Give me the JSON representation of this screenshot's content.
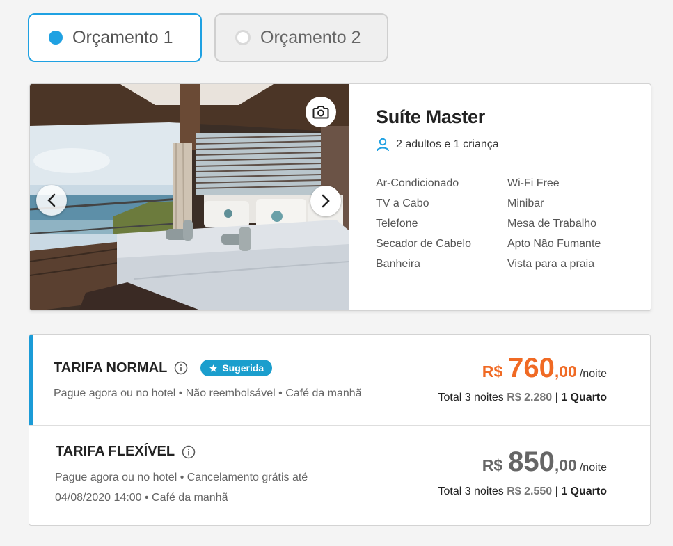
{
  "tabs": [
    {
      "label": "Orçamento 1",
      "selected": true
    },
    {
      "label": "Orçamento 2",
      "selected": false
    }
  ],
  "room": {
    "name": "Suíte Master",
    "occupancy": "2 adultos e 1 criança",
    "amenities": [
      "Ar-Condicionado",
      "Wi-Fi Free",
      "TV a Cabo",
      "Minibar",
      "Telefone",
      "Mesa de Trabalho",
      "Secador de Cabelo",
      "Apto Não Fumante",
      "Banheira",
      "Vista para a praia"
    ],
    "icons": {
      "camera": "camera-icon",
      "prev": "chevron-left-icon",
      "next": "chevron-right-icon",
      "person": "person-icon"
    }
  },
  "rates": [
    {
      "name": "TARIFA NORMAL",
      "badge": "Sugerida",
      "description_lines": [
        "Pague agora ou no hotel • Não reembolsável • Café da manhã"
      ],
      "currency": "R$",
      "price_int": "760",
      "price_dec": ",00",
      "per": "/noite",
      "total_label": "Total 3 noites",
      "total_value": "R$ 2.280",
      "separator": "|",
      "rooms": "1 Quarto",
      "color": "#f06a24"
    },
    {
      "name": "TARIFA FLEXÍVEL",
      "badge": "",
      "description_lines": [
        "Pague agora ou no hotel • Cancelamento grátis até",
        "04/08/2020 14:00 • Café da manhã"
      ],
      "currency": "R$",
      "price_int": "850",
      "price_dec": ",00",
      "per": "/noite",
      "total_label": "Total 3 noites",
      "total_value": "R$ 2.550",
      "separator": "|",
      "rooms": "1 Quarto",
      "color": "#666666"
    }
  ],
  "colors": {
    "accent": "#1fa1e2",
    "badge": "#1b9ecd",
    "highlight_price": "#f06a24"
  }
}
